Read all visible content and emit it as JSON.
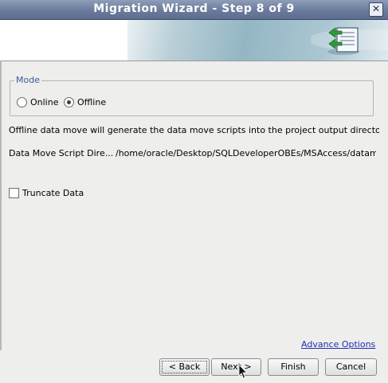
{
  "window": {
    "title": "Migration Wizard - Step 8 of 9",
    "close_glyph": "✕"
  },
  "mode": {
    "legend": "Mode",
    "options": [
      "Online",
      "Offline"
    ],
    "selected": "Offline"
  },
  "info_text": "Offline data move will generate the  data move scripts into the project output directo...",
  "directory": {
    "label": "Data Move Script Dire...",
    "value": "/home/oracle/Desktop/SQLDeveloperOBEs/MSAccess/datamove"
  },
  "truncate": {
    "label": "Truncate Data",
    "checked": false
  },
  "advance_options": "Advance Options",
  "buttons": {
    "back": "< Back",
    "next": "Next >",
    "finish": "Finish",
    "cancel": "Cancel"
  },
  "icons": {
    "banner": "database-migration-icon",
    "close": "close-icon",
    "cursor": "mouse-cursor-icon"
  }
}
